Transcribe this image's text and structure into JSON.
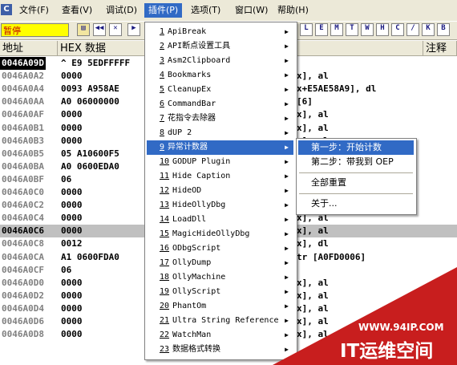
{
  "app_icon": "C",
  "menubar": [
    "文件(F)",
    "查看(V)",
    "调试(D)",
    "插件(P)",
    "选项(T)",
    "窗口(W)",
    "帮助(H)"
  ],
  "toolbar": {
    "status": "暂停",
    "buttons": [
      "L",
      "E",
      "M",
      "T",
      "W",
      "H",
      "C",
      "/",
      "K",
      "B"
    ]
  },
  "columns": {
    "address": "地址",
    "hex": "HEX 数据",
    "comment": "注释"
  },
  "rows": [
    {
      "addr": "0046A09D",
      "hex": "^ E9 5EDFFFFF",
      "asm": ""
    },
    {
      "addr": "0046A0A2",
      "hex": "0000",
      "asm": "x], al"
    },
    {
      "addr": "0046A0A4",
      "hex": "0093 A958AE",
      "asm": "x+E5AE58A9], dl"
    },
    {
      "addr": "0046A0AA",
      "hex": "A0 06000000",
      "asm": " [6]"
    },
    {
      "addr": "0046A0AF",
      "hex": "0000",
      "asm": "x], al"
    },
    {
      "addr": "0046A0B1",
      "hex": "0000",
      "asm": "x], al"
    },
    {
      "addr": "0046A0B3",
      "hex": "0000",
      "asm": "x], al"
    },
    {
      "addr": "0046A0B5",
      "hex": "05 A10600F5",
      "asm": ""
    },
    {
      "addr": "0046A0BA",
      "hex": "A0 0600EDA0",
      "asm": ""
    },
    {
      "addr": "0046A0BF",
      "hex": "06",
      "asm": ""
    },
    {
      "addr": "0046A0C0",
      "hex": "0000",
      "asm": ""
    },
    {
      "addr": "0046A0C2",
      "hex": "0000",
      "asm": ""
    },
    {
      "addr": "0046A0C4",
      "hex": "0000",
      "asm": "x], al"
    },
    {
      "addr": "0046A0C6",
      "hex": "0000",
      "asm": "x], al"
    },
    {
      "addr": "0046A0C8",
      "hex": "0012",
      "asm": "x], dl"
    },
    {
      "addr": "0046A0CA",
      "hex": "A1 0600FDA0",
      "asm": "tr [A0FD0006]"
    },
    {
      "addr": "0046A0CF",
      "hex": "06",
      "asm": ""
    },
    {
      "addr": "0046A0D0",
      "hex": "0000",
      "asm": "x], al"
    },
    {
      "addr": "0046A0D2",
      "hex": "0000",
      "asm": "x], al"
    },
    {
      "addr": "0046A0D4",
      "hex": "0000",
      "asm": "x], al"
    },
    {
      "addr": "0046A0D6",
      "hex": "0000",
      "asm": "x], al"
    },
    {
      "addr": "0046A0D8",
      "hex": "0000",
      "asm": "x], al"
    }
  ],
  "plugin_menu": [
    {
      "num": "1",
      "label": "ApiBreak",
      "sub": true
    },
    {
      "num": "2",
      "label": "API断点设置工具",
      "sub": true
    },
    {
      "num": "3",
      "label": "Asm2Clipboard",
      "sub": true
    },
    {
      "num": "4",
      "label": "Bookmarks",
      "sub": true
    },
    {
      "num": "5",
      "label": "CleanupEx",
      "sub": true
    },
    {
      "num": "6",
      "label": "CommandBar",
      "sub": true
    },
    {
      "num": "7",
      "label": "花指令去除器",
      "sub": true
    },
    {
      "num": "8",
      "label": "dUP 2",
      "sub": true
    },
    {
      "num": "9",
      "label": "异常计数器",
      "sub": true
    },
    {
      "num": "10",
      "label": "GODUP Plugin",
      "sub": true
    },
    {
      "num": "11",
      "label": "Hide Caption",
      "sub": true
    },
    {
      "num": "12",
      "label": "HideOD",
      "sub": true
    },
    {
      "num": "13",
      "label": "HideOllyDbg",
      "sub": true
    },
    {
      "num": "14",
      "label": "LoadDll",
      "sub": true
    },
    {
      "num": "15",
      "label": "MagicHideOllyDbg",
      "sub": true
    },
    {
      "num": "16",
      "label": "ODbgScript",
      "sub": true
    },
    {
      "num": "17",
      "label": "OllyDump",
      "sub": true
    },
    {
      "num": "18",
      "label": "OllyMachine",
      "sub": true
    },
    {
      "num": "19",
      "label": "OllyScript",
      "sub": true
    },
    {
      "num": "20",
      "label": "PhantOm",
      "sub": true
    },
    {
      "num": "21",
      "label": "Ultra String Reference",
      "sub": true
    },
    {
      "num": "22",
      "label": "WatchMan",
      "sub": true
    },
    {
      "num": "23",
      "label": "数据格式转换",
      "sub": true
    }
  ],
  "submenu": {
    "step1": "第一步：开始计数",
    "step2": "第二步：带我到 OEP",
    "reset": "全部重置",
    "about": "关于..."
  },
  "watermark": {
    "site": "WWW.94IP.COM",
    "brand": "IT运维空间"
  },
  "colors": {
    "menu_highlight": "#316ac5",
    "paused_bg": "#ffff00",
    "paused_text": "#c00000",
    "watermark_red": "#c81e1e"
  }
}
